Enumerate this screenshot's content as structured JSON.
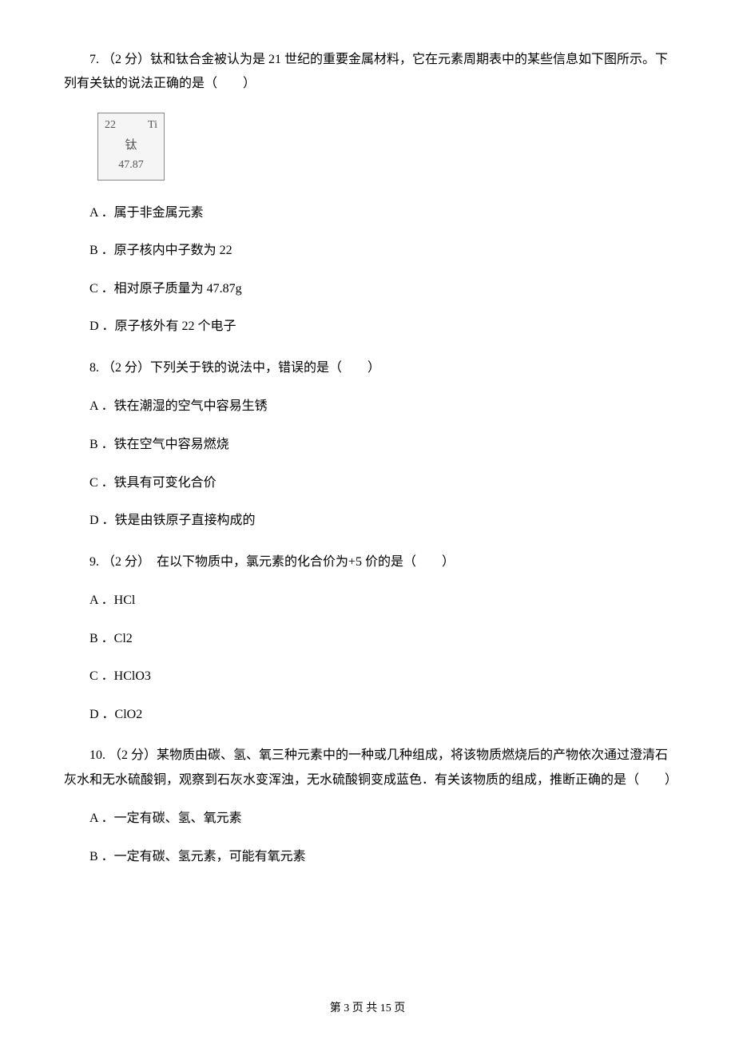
{
  "q7": {
    "text": "7. （2 分）钛和钛合金被认为是 21 世纪的重要金属材料，它在元素周期表中的某些信息如下图所示。下列有关钛的说法正确的是（　　）",
    "element": {
      "number": "22",
      "symbol": "Ti",
      "name": "钛",
      "mass": "47.87"
    },
    "options": {
      "a": "A ．属于非金属元素",
      "b": "B ．原子核内中子数为 22",
      "c": "C ．相对原子质量为 47.87g",
      "d": "D ．原子核外有 22 个电子"
    }
  },
  "q8": {
    "text": "8. （2 分）下列关于铁的说法中，错误的是（　　）",
    "options": {
      "a": "A ．铁在潮湿的空气中容易生锈",
      "b": "B ．铁在空气中容易燃烧",
      "c": "C ．铁具有可变化合价",
      "d": "D ．铁是由铁原子直接构成的"
    }
  },
  "q9": {
    "text": "9. （2 分）　在以下物质中，氯元素的化合价为+5 价的是（　　）",
    "options": {
      "a": "A ．HCl",
      "b": "B ．Cl2",
      "c": "C ．HClO3",
      "d": "D ．ClO2"
    }
  },
  "q10": {
    "text": "10. （2 分）某物质由碳、氢、氧三种元素中的一种或几种组成，将该物质燃烧后的产物依次通过澄清石灰水和无水硫酸铜，观察到石灰水变浑浊，无水硫酸铜变成蓝色．有关该物质的组成，推断正确的是（　　）",
    "options": {
      "a": "A ．一定有碳、氢、氧元素",
      "b": "B ．一定有碳、氢元素，可能有氧元素"
    }
  },
  "footer": "第 3 页 共 15 页"
}
